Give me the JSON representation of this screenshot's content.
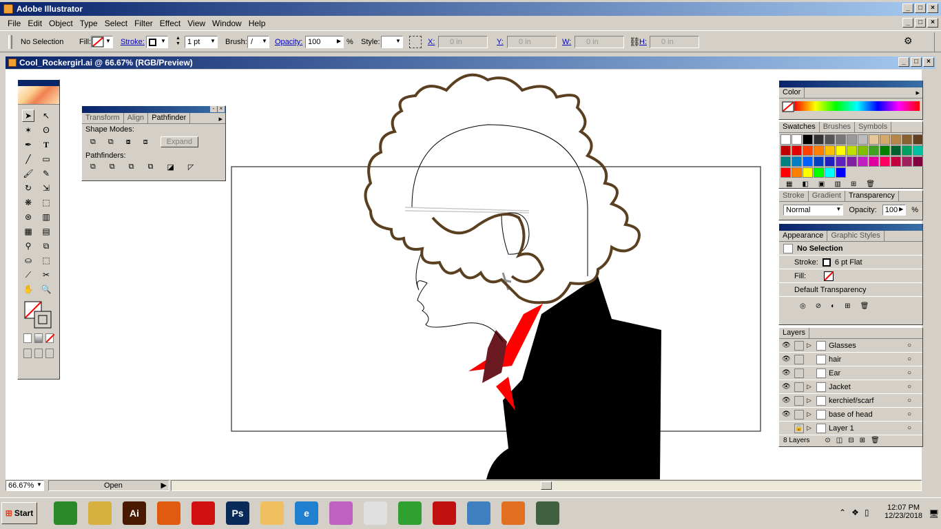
{
  "app": {
    "title": "Adobe Illustrator"
  },
  "menu": [
    "File",
    "Edit",
    "Object",
    "Type",
    "Select",
    "Filter",
    "Effect",
    "View",
    "Window",
    "Help"
  ],
  "control": {
    "selection": "No Selection",
    "fill_label": "Fill:",
    "stroke_label": "Stroke:",
    "stroke_weight": "1 pt",
    "brush_label": "Brush:",
    "opacity_label": "Opacity:",
    "opacity_value": "100",
    "percent": "%",
    "style_label": "Style:",
    "x_label": "X:",
    "x_value": "0 in",
    "y_label": "Y:",
    "y_value": "0 in",
    "w_label": "W:",
    "w_value": "0 in",
    "h_label": "H:",
    "h_value": "0 in"
  },
  "document": {
    "title": "Cool_Rockergirl.ai @ 66.67% (RGB/Preview)"
  },
  "pathfinder": {
    "tabs": [
      "Transform",
      "Align",
      "Pathfinder"
    ],
    "shape_modes": "Shape Modes:",
    "expand": "Expand",
    "pathfinders": "Pathfinders:"
  },
  "color_panel": {
    "tab": "Color"
  },
  "swatches_panel": {
    "tabs": [
      "Swatches",
      "Brushes",
      "Symbols"
    ],
    "colors": [
      "#ffffff",
      "#ffffff",
      "#000000",
      "#333333",
      "#555555",
      "#777777",
      "#999999",
      "#bbbbbb",
      "#e8c89a",
      "#d4a86a",
      "#b8864a",
      "#8a6030",
      "#604020",
      "#c00000",
      "#e00000",
      "#ff4000",
      "#ff8000",
      "#ffc000",
      "#ffff00",
      "#c0e000",
      "#80c000",
      "#40a020",
      "#008000",
      "#006030",
      "#00a060",
      "#00c0a0",
      "#008080",
      "#0080c0",
      "#0060ff",
      "#0040c0",
      "#2020c0",
      "#6020c0",
      "#8020a0",
      "#c020c0",
      "#e000a0",
      "#ff0060",
      "#c00040",
      "#a02060",
      "#800040",
      "#ff0000",
      "#ff8000",
      "#ffff00",
      "#00ff00",
      "#00ffff",
      "#0000ff"
    ]
  },
  "stroke_panel": {
    "tabs": [
      "Stroke",
      "Gradient",
      "Transparency"
    ],
    "blend_mode": "Normal",
    "opacity_label": "Opacity:",
    "opacity_value": "100",
    "percent": "%"
  },
  "appearance_panel": {
    "tabs": [
      "Appearance",
      "Graphic Styles"
    ],
    "title": "No Selection",
    "stroke_label": "Stroke:",
    "stroke_value": "6 pt Flat",
    "fill_label": "Fill:",
    "transparency": "Default Transparency"
  },
  "layers_panel": {
    "tab": "Layers",
    "layers": [
      {
        "name": "Glasses",
        "visible": true,
        "expand": true
      },
      {
        "name": "hair",
        "visible": true,
        "expand": false
      },
      {
        "name": "Ear",
        "visible": true,
        "expand": false
      },
      {
        "name": "Jacket",
        "visible": true,
        "expand": true
      },
      {
        "name": "kerchief/scarf",
        "visible": true,
        "expand": true
      },
      {
        "name": "base of head",
        "visible": true,
        "expand": true
      },
      {
        "name": "Layer 1",
        "visible": false,
        "expand": true
      }
    ],
    "count": "8 Layers"
  },
  "status": {
    "zoom": "66.67%",
    "status_text": "Open"
  },
  "taskbar": {
    "start": "Start",
    "time": "12:07 PM",
    "date": "12/23/2018",
    "apps": [
      {
        "name": "gecko-icon",
        "color": "#2a8a2a",
        "label": ""
      },
      {
        "name": "file-explorer-icon",
        "color": "#d8b040",
        "label": ""
      },
      {
        "name": "illustrator-icon",
        "color": "#4a1a00",
        "label": "Ai"
      },
      {
        "name": "firefox-icon",
        "color": "#e05a10",
        "label": ""
      },
      {
        "name": "creative-cloud-icon",
        "color": "#d01010",
        "label": ""
      },
      {
        "name": "photoshop-icon",
        "color": "#0a2a5a",
        "label": "Ps"
      },
      {
        "name": "illustrator-flower-icon",
        "color": "#f0c060",
        "label": ""
      },
      {
        "name": "internet-explorer-icon",
        "color": "#2080d0",
        "label": "e"
      },
      {
        "name": "butterfly-icon",
        "color": "#c060c0",
        "label": ""
      },
      {
        "name": "calculator-icon",
        "color": "#e0e0e0",
        "label": ""
      },
      {
        "name": "office-icon",
        "color": "#30a030",
        "label": ""
      },
      {
        "name": "acrobat-icon",
        "color": "#c01010",
        "label": ""
      },
      {
        "name": "quill-icon",
        "color": "#4080c0",
        "label": ""
      },
      {
        "name": "firefox2-icon",
        "color": "#e07020",
        "label": ""
      },
      {
        "name": "network-icon",
        "color": "#406040",
        "label": ""
      }
    ]
  }
}
